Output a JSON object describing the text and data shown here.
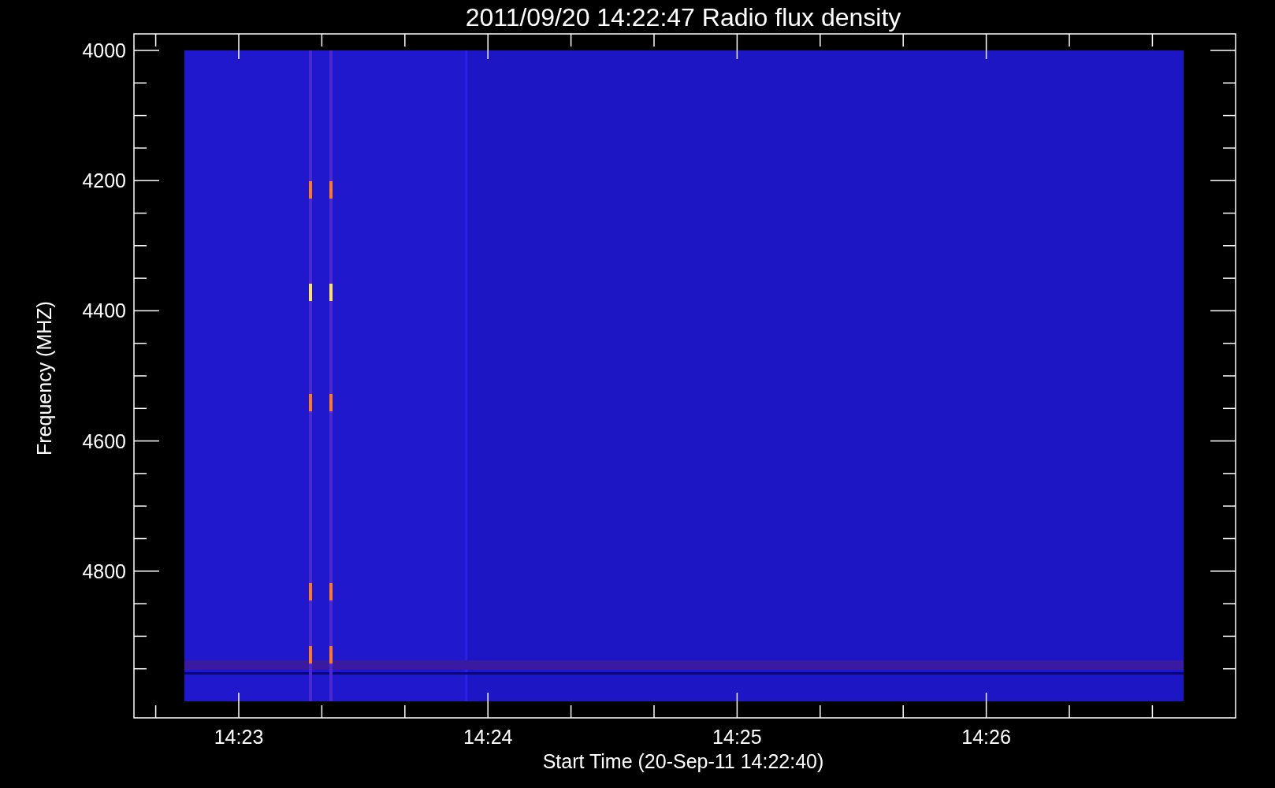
{
  "title": "2011/09/20 14:22:47 Radio flux density",
  "y_axis": {
    "label": "Frequency (MHZ)",
    "ticks": [
      "4000",
      "4200",
      "4400",
      "4600",
      "4800"
    ]
  },
  "x_axis": {
    "label": "Start Time (20-Sep-11 14:22:40)",
    "ticks": [
      "14:23",
      "14:24",
      "14:25",
      "14:26"
    ]
  }
}
